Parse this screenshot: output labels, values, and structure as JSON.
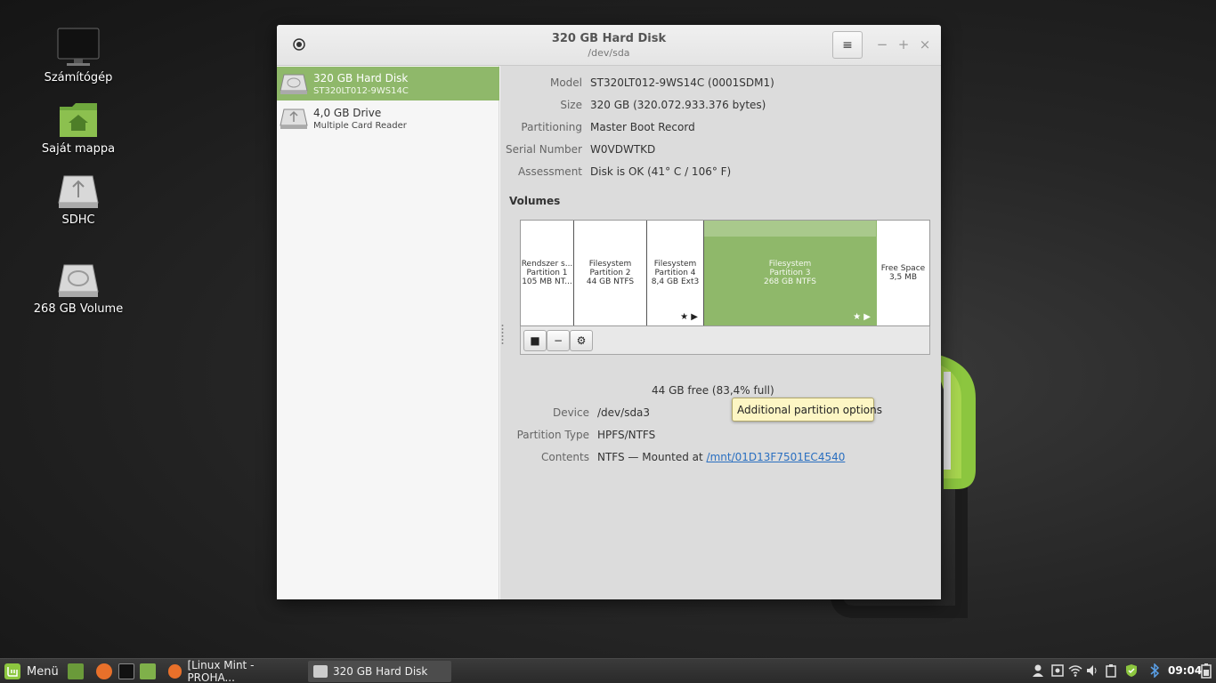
{
  "desktop": {
    "icons": [
      {
        "label": "Számítógép",
        "icon": "monitor-icon"
      },
      {
        "label": "Saját mappa",
        "icon": "home-folder-icon"
      },
      {
        "label": "SDHC",
        "icon": "usb-drive-icon"
      },
      {
        "label": "268 GB Volume",
        "icon": "hard-disk-icon"
      }
    ]
  },
  "window": {
    "title": "320 GB Hard Disk",
    "subtitle": "/dev/sda",
    "controls": {
      "minimize": "−",
      "maximize": "+",
      "close": "×",
      "menu": "≡"
    }
  },
  "sidebar": {
    "items": [
      {
        "name": "320 GB Hard Disk",
        "sub": "ST320LT012-9WS14C",
        "selected": true
      },
      {
        "name": "4,0 GB Drive",
        "sub": "Multiple Card  Reader",
        "selected": false
      }
    ]
  },
  "disk": {
    "model_label": "Model",
    "model": "ST320LT012-9WS14C (0001SDM1)",
    "size_label": "Size",
    "size": "320 GB (320.072.933.376 bytes)",
    "partitioning_label": "Partitioning",
    "partitioning": "Master Boot Record",
    "serial_label": "Serial Number",
    "serial": "W0VDWTKD",
    "assessment_label": "Assessment",
    "assessment": "Disk is OK (41° C / 106° F)"
  },
  "volumes": {
    "heading": "Volumes",
    "items": [
      {
        "line1": "Rendszer s...",
        "line2": "Partition 1",
        "line3": "105 MB NT...",
        "marks": ""
      },
      {
        "line1": "Filesystem",
        "line2": "Partition 2",
        "line3": "44 GB NTFS",
        "marks": ""
      },
      {
        "line1": "Filesystem",
        "line2": "Partition 4",
        "line3": "8,4 GB Ext3",
        "marks": "★ ▶"
      },
      {
        "line1": "Filesystem",
        "line2": "Partition 3",
        "line3": "268 GB NTFS",
        "marks": "★ ▶"
      },
      {
        "line1": "Free Space",
        "line2": "3,5 MB",
        "line3": "",
        "marks": ""
      }
    ],
    "toolbar": {
      "stop": "■",
      "remove": "−",
      "options": "⚙"
    }
  },
  "tooltip": "Additional partition options",
  "partition": {
    "size_value": "44 GB free (83,4% full)",
    "device_label": "Device",
    "device": "/dev/sda3",
    "type_label": "Partition Type",
    "type": "HPFS/NTFS",
    "contents_label": "Contents",
    "contents_prefix": "NTFS — Mounted at ",
    "mount_link": "/mnt/01D13F7501EC4540"
  },
  "taskbar": {
    "menu_label": "Menü",
    "tasks": [
      {
        "label": "[Linux Mint - PROHA..."
      },
      {
        "label": "320 GB Hard Disk"
      }
    ],
    "clock": "09:04"
  },
  "colors": {
    "accent": "#8fb86a",
    "tooltip_bg": "#fdf6c4",
    "link": "#2a6fc0"
  }
}
